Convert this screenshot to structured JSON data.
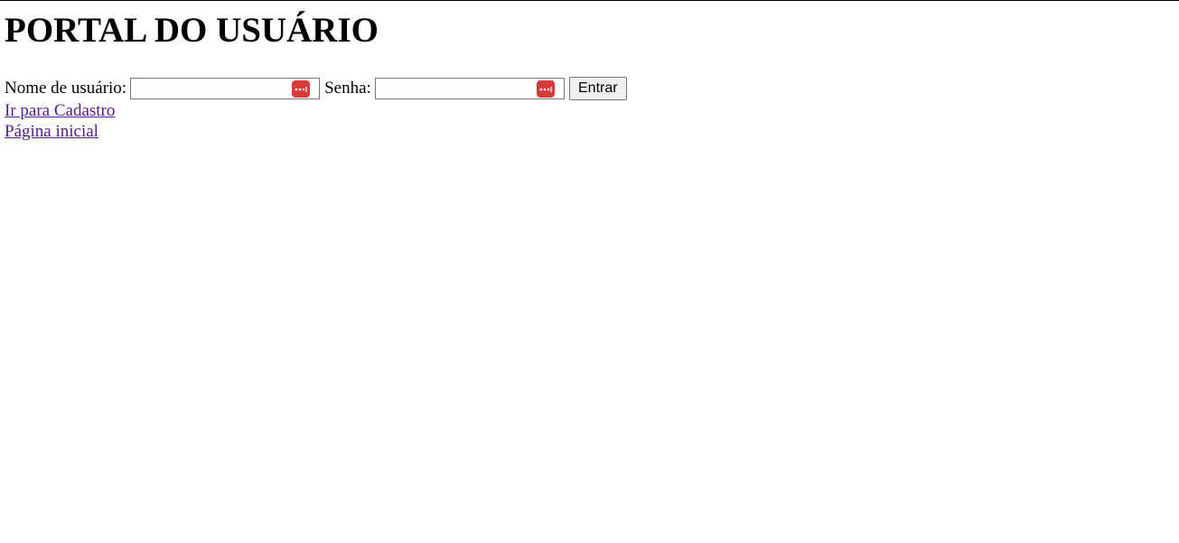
{
  "page": {
    "title": "PORTAL DO USUÁRIO"
  },
  "login": {
    "username_label": "Nome de usuário:",
    "username_value": "",
    "password_label": "Senha:",
    "password_value": "",
    "submit_label": "Entrar",
    "password_manager_icon": "password-manager-dots-icon"
  },
  "links": {
    "register": "Ir para Cadastro",
    "home": "Página inicial"
  },
  "colors": {
    "visited_link": "#551a8b",
    "password_manager_badge": "#d93a3a",
    "button_bg": "#efefef"
  }
}
